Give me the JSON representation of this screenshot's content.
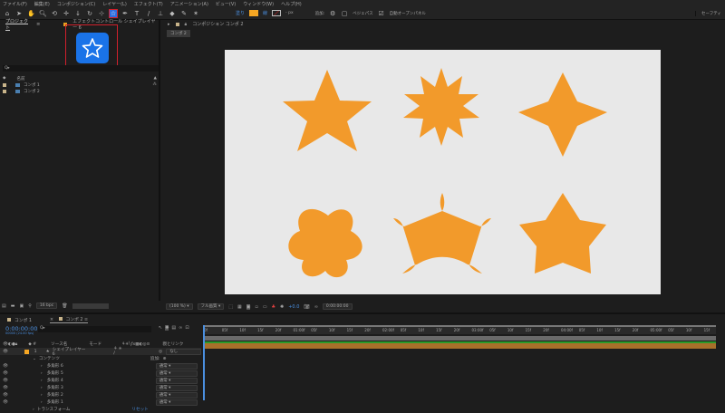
{
  "menu": [
    "ファイル(F)",
    "編集(E)",
    "コンポジション(C)",
    "レイヤー(L)",
    "エフェクト(T)",
    "アニメーション(A)",
    "ビュー(V)",
    "ウィンドウ(W)",
    "ヘルプ(H)"
  ],
  "toolbar": {
    "fill_label": "塗り",
    "stroke_label": "線",
    "stroke_width": "- px",
    "add_label": "追加:",
    "bezier_label": "ベジェパス",
    "auto_open_label": "自動オープンパネル",
    "workspace_label": "セーフティ",
    "fill_color": "#f5a623"
  },
  "project": {
    "tab": "プロジェクト",
    "effects_tab": "エフェクトコントロール シェイプレイヤー 6",
    "search_placeholder": "Q▸",
    "col_name": "名前",
    "items": [
      "コンポ 1",
      "コンポ 2"
    ],
    "bpc": "16 bpc"
  },
  "viewer": {
    "tab": "コンポジション コンポ 2",
    "sub_tab": "コンポ 2",
    "zoom": "(100 %)",
    "resolution": "フル画質",
    "timecode": "0:00:00:00"
  },
  "timeline": {
    "tabs": [
      "コンポ 1",
      "コンポ 2"
    ],
    "timecode": "0:00:00:00",
    "frames": "00000 (24.00 fps)",
    "cols": {
      "source": "ソース名",
      "mode": "モード",
      "parent": "親とリンク"
    },
    "layer": {
      "num": "1",
      "name": "シェイプレイヤー 6",
      "parent": "なし"
    },
    "contents": "コンテンツ",
    "add_label": "追加:",
    "shapes": [
      "多角形 6",
      "多角形 5",
      "多角形 4",
      "多角形 3",
      "多角形 2",
      "多角形 1"
    ],
    "blend": "通常",
    "transform": "トランスフォーム",
    "reset": "リセット",
    "ruler": [
      "0f",
      "05f",
      "10f",
      "15f",
      "20f",
      "01:00f",
      "05f",
      "10f",
      "15f",
      "20f",
      "02:00f",
      "05f",
      "10f",
      "15f",
      "20f",
      "03:00f",
      "05f",
      "10f",
      "15f",
      "20f",
      "04:00f",
      "05f",
      "10f",
      "15f",
      "20f",
      "05:00f",
      "05f",
      "10f",
      "15f"
    ]
  },
  "shape_color": "#f29a2b"
}
